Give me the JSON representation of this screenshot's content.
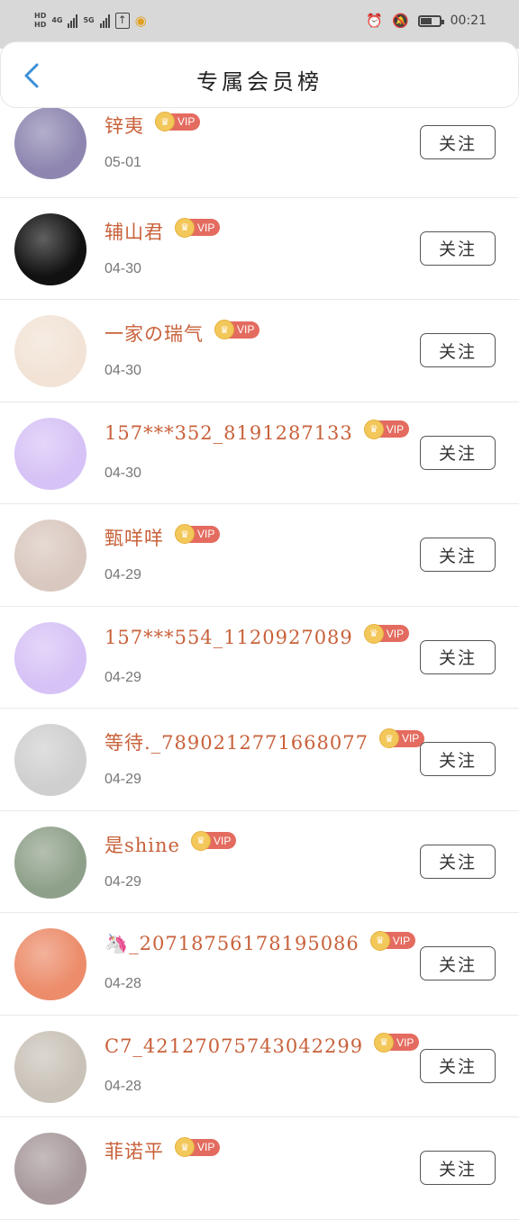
{
  "status_bar": {
    "left": [
      "HD",
      "4G",
      "5G"
    ],
    "time": "00:21"
  },
  "header": {
    "title": "专属会员榜"
  },
  "vip_label": "VIP",
  "follow_label": "关注",
  "members": [
    {
      "name": "锌夷",
      "date": "05-01",
      "avatar": "#8e86b0"
    },
    {
      "name": "辅山君",
      "date": "04-30",
      "avatar": "#111111"
    },
    {
      "name": "一家の瑞气",
      "date": "04-30",
      "avatar": "#f2e3d6"
    },
    {
      "name": "157***352_8191287133",
      "date": "04-30",
      "avatar": "#d6c2f6"
    },
    {
      "name": "甄咩咩",
      "date": "04-29",
      "avatar": "#d9c8bf"
    },
    {
      "name": "157***554_1120927089",
      "date": "04-29",
      "avatar": "#d6c2f6"
    },
    {
      "name": "等待._7890212771668077",
      "date": "04-29",
      "avatar": "#cfcfcf"
    },
    {
      "name": "是shine",
      "date": "04-29",
      "avatar": "#8fa08a"
    },
    {
      "name": "🦄_20718756178195086",
      "date": "04-28",
      "avatar": "#ec8c6a"
    },
    {
      "name": "C7_42127075743042299",
      "date": "04-28",
      "avatar": "#c9c2b8"
    },
    {
      "name": "菲诺平",
      "date": "",
      "avatar": "#a89a9c"
    }
  ]
}
